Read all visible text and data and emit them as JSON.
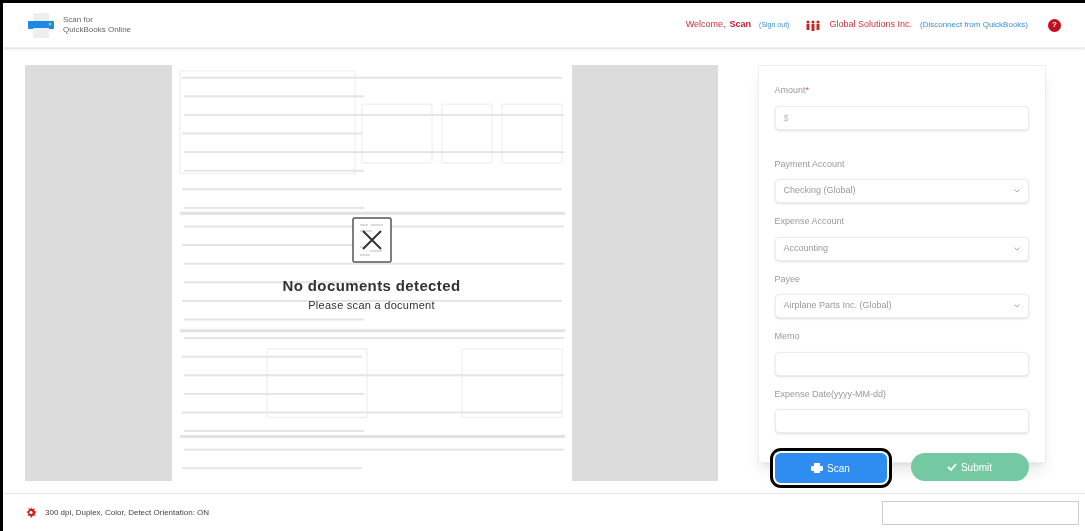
{
  "header": {
    "app_title_line1": "Scan for",
    "app_title_line2": "QuickBooks Online",
    "welcome": "Welcome,",
    "user": "Scan",
    "sign_out": "(Sign out)",
    "company": "Global Solutions Inc.",
    "disconnect": "(Disconnect from QuickBooks)",
    "help": "?"
  },
  "preview": {
    "kind": "picture",
    "message": "No documents detected",
    "hint": "Please scan a document"
  },
  "form": {
    "fields": [
      {
        "kind": "input",
        "label": "Amount",
        "required": true,
        "placeholder": "$"
      },
      {
        "kind": "select",
        "label": "Payment Account",
        "required": false,
        "value": "Checking (Global)"
      },
      {
        "kind": "select",
        "label": "Expense Account",
        "required": false,
        "value": "Accounting"
      },
      {
        "kind": "select",
        "label": "Payee",
        "required": false,
        "value": "Airplane Parts Inc. (Global)"
      },
      {
        "kind": "input",
        "label": "Memo",
        "required": false
      },
      {
        "kind": "input",
        "label": "Expense Date(yyyy-MM-dd)",
        "required": false
      }
    ],
    "required_mark": "*",
    "scan_button": {
      "label": "Scan",
      "highlighted": true
    },
    "submit_button": {
      "label": "Submit",
      "disabled": true
    }
  },
  "footer": {
    "settings": "300 dpi, Duplex, Color, Detect Orientation: ON"
  }
}
